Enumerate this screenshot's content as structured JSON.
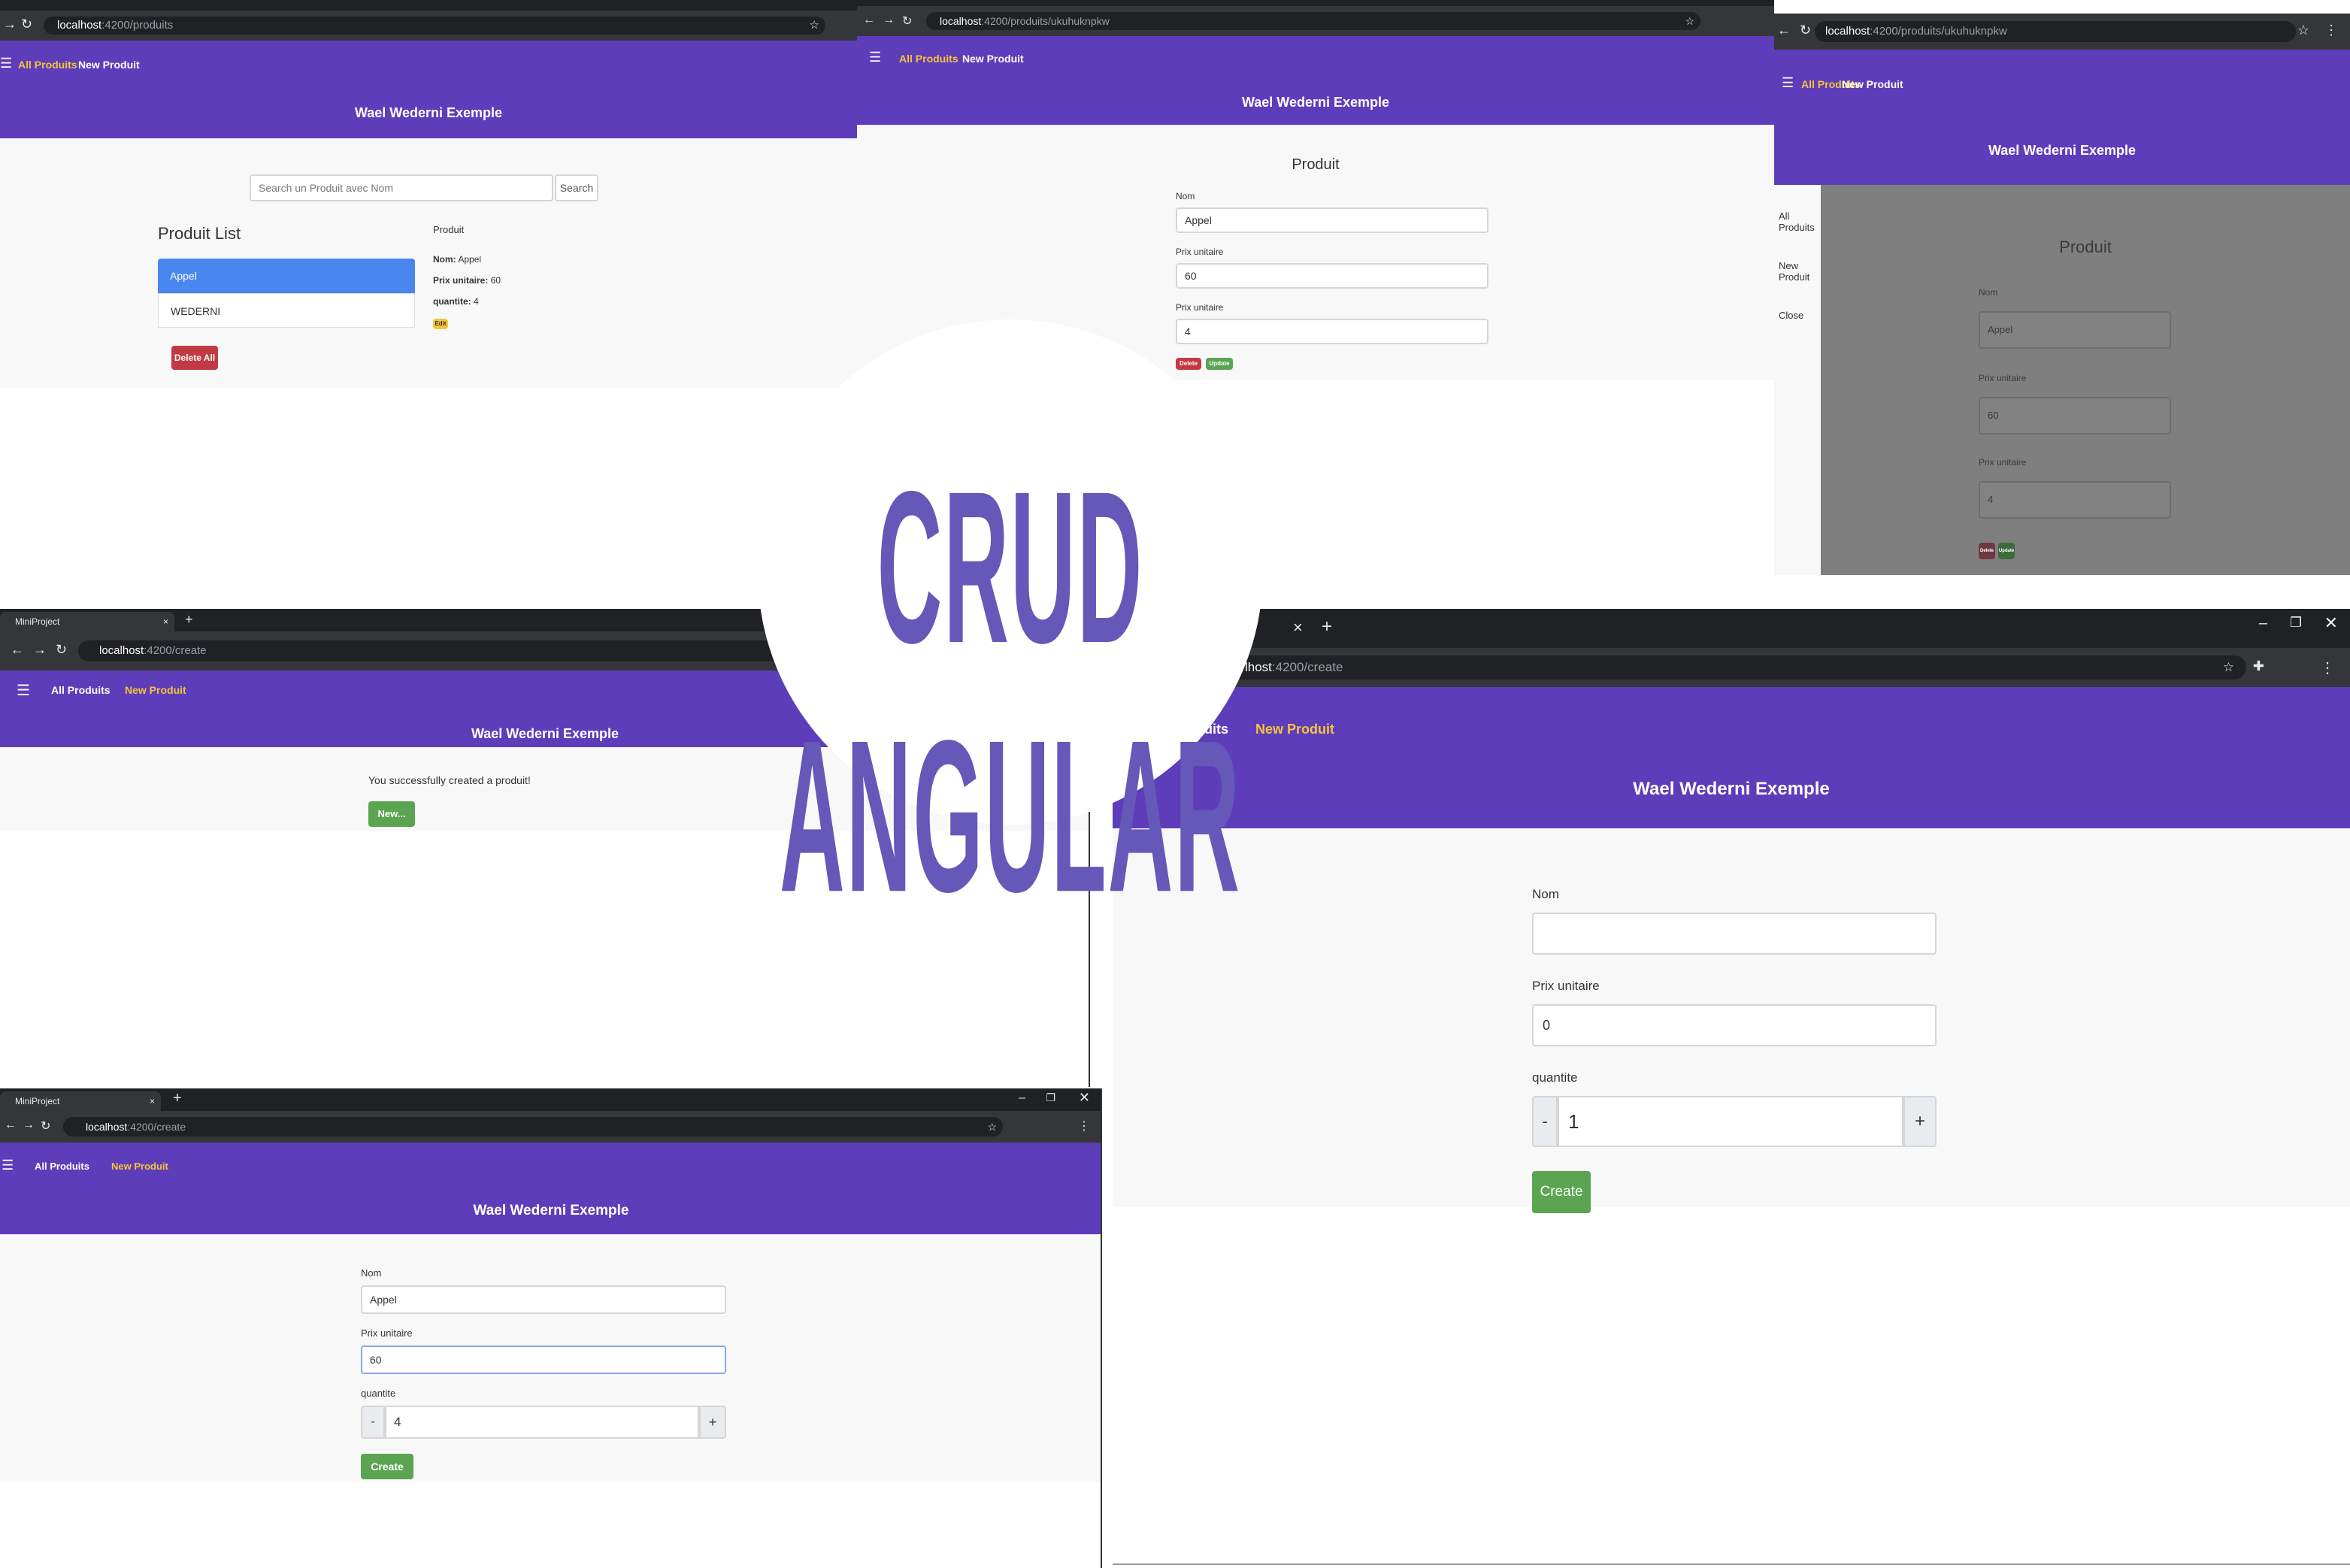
{
  "title": "CRUD ANGULAR",
  "brand": "Wael Wederni Exemple",
  "nav": {
    "all": "All Produits",
    "new": "New Produit"
  },
  "panel_list": {
    "url_host": "localhost",
    "url_path": ":4200/produits",
    "search_placeholder": "Search un Produit avec Nom",
    "search_button": "Search",
    "list_title": "Produit List",
    "items": [
      "Appel",
      "WEDERNI"
    ],
    "delete_all": "Delete All",
    "detail_title": "Produit",
    "detail_nom_label": "Nom:",
    "detail_nom_value": "Appel",
    "detail_prix_label": "Prix unitaire:",
    "detail_prix_value": "60",
    "detail_qte_label": "quantite:",
    "detail_qte_value": "4",
    "edit_badge": "Edit"
  },
  "panel_edit": {
    "url_host": "localhost",
    "url_path": ":4200/produits/ukuhuknpkw",
    "heading": "Produit",
    "nom_label": "Nom",
    "nom_value": "Appel",
    "prix_label": "Prix unitaire",
    "prix_value": "60",
    "qte_label": "Prix unitaire",
    "qte_value": "4",
    "delete": "Delete",
    "update": "Update"
  },
  "panel_sidebar": {
    "url_host": "localhost",
    "url_path": ":4200/produits/ukuhuknpkw",
    "side_items": [
      "All Produits",
      "New Produit",
      "Close"
    ],
    "heading": "Produit",
    "nom_label": "Nom",
    "nom_value": "Appel",
    "prix_label": "Prix unitaire",
    "prix_value": "60",
    "qte_label": "Prix unitaire",
    "qte_value": "4",
    "delete": "Delete",
    "update": "Update"
  },
  "panel_success": {
    "tab_title": "MiniProject",
    "url_host": "localhost",
    "url_path": ":4200/create",
    "message": "You successfully created a produit!",
    "new_button": "New..."
  },
  "panel_create_big": {
    "url_host": "localhost",
    "url_path": ":4200/create",
    "url_visible_host": "lhost",
    "nav_all_partial": "uits",
    "nom_label": "Nom",
    "nom_value": "",
    "prix_label": "Prix unitaire",
    "prix_value": "0",
    "qte_label": "quantite",
    "qte_value": "1",
    "minus": "-",
    "plus": "+",
    "create": "Create"
  },
  "panel_create_small": {
    "tab_title": "MiniProject",
    "url_host": "localhost",
    "url_path": ":4200/create",
    "nom_label": "Nom",
    "nom_value": "Appel",
    "prix_label": "Prix unitaire",
    "prix_value": "60",
    "qte_label": "quantite",
    "qte_value": "4",
    "minus": "-",
    "plus": "+",
    "create": "Create"
  },
  "icons": {
    "menu": "hamburger-icon",
    "back": "back-arrow-icon",
    "forward": "forward-arrow-icon",
    "reload": "reload-icon",
    "star": "star-icon",
    "extensions": "puzzle-icon",
    "close": "close-icon",
    "new_tab": "plus-icon",
    "minimize": "minimize-icon",
    "restore": "restore-icon",
    "more": "more-vertical-icon"
  },
  "colors": {
    "nav": "#5e3dba",
    "accent": "#f5c53a",
    "primary": "#4a86f0",
    "danger": "#c13a43",
    "success": "#5ba452",
    "title": "#6558b8"
  }
}
